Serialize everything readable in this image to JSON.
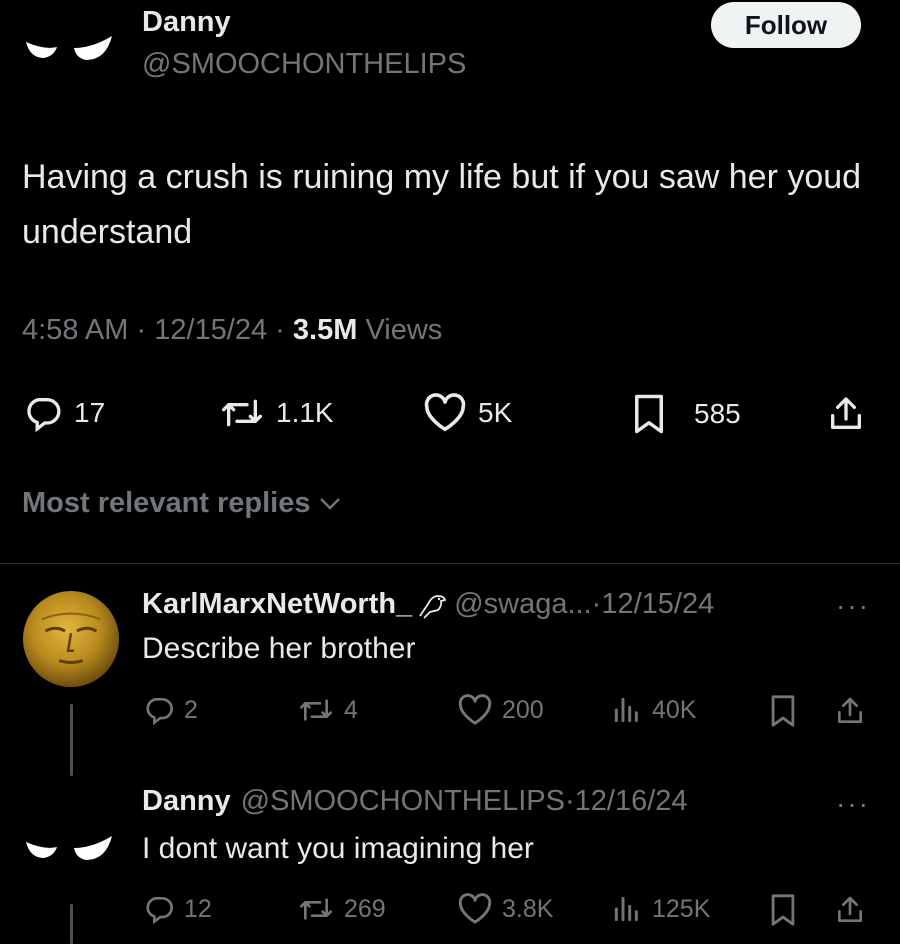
{
  "tweet": {
    "author_name": "Danny",
    "author_handle": "@SMOOCHONTHELIPS",
    "follow_label": "Follow",
    "text": "Having a crush is ruining my life but if you saw her youd understand",
    "time": "4:58 AM",
    "date": "12/15/24",
    "views_count": "3.5M",
    "views_label": "Views",
    "stats": {
      "replies": "17",
      "reposts": "1.1K",
      "likes": "5K",
      "bookmarks": "585"
    }
  },
  "replies_sort": {
    "label": "Most relevant replies"
  },
  "replies": [
    {
      "name": "KarlMarxNetWorth_",
      "handle": "@swaga...",
      "date": "12/15/24",
      "text": "Describe her brother",
      "stats": {
        "replies": "2",
        "reposts": "4",
        "likes": "200",
        "views": "40K"
      }
    },
    {
      "name": "Danny",
      "handle": "@SMOOCHONTHELIPS",
      "date": "12/16/24",
      "text": "I dont want you imagining her",
      "stats": {
        "replies": "12",
        "reposts": "269",
        "likes": "3.8K",
        "views": "125K"
      }
    }
  ],
  "separator": "·",
  "more_glyph": "···",
  "icons": [
    "eyes-avatar",
    "gold-mask-avatar",
    "reply-icon",
    "repost-icon",
    "like-icon",
    "bookmark-icon",
    "share-icon",
    "views-icon",
    "chevron-down-icon",
    "bird-icon"
  ]
}
